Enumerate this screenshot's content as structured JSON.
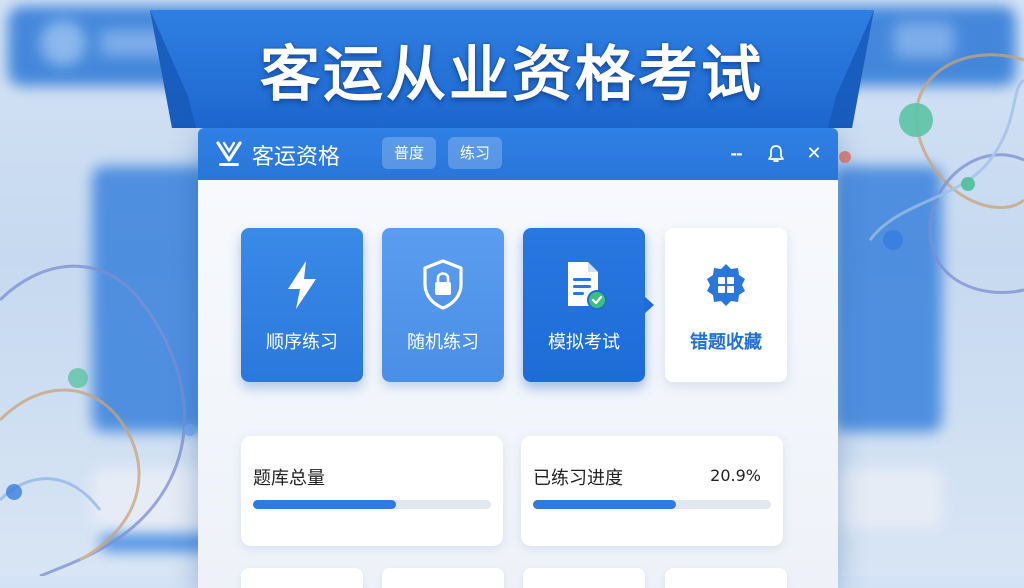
{
  "banner": {
    "title": "客运从业资格考试"
  },
  "window": {
    "app_title": "客运资格",
    "tabs": [
      {
        "label": "普度"
      },
      {
        "label": "练习"
      }
    ],
    "controls": {
      "minimize_label": "--",
      "bell_icon": "bell-icon",
      "close_label": "✕"
    }
  },
  "tiles": [
    {
      "label": "顺序练习",
      "icon": "lightning-icon"
    },
    {
      "label": "随机练习",
      "icon": "shield-lock-icon"
    },
    {
      "label": "模拟考试",
      "icon": "document-check-icon"
    },
    {
      "label": "错题收藏",
      "icon": "grid-badge-icon"
    }
  ],
  "stats": [
    {
      "title": "题库总量",
      "value": "",
      "progress": 0.6
    },
    {
      "title": "已练习进度",
      "value": "20.9%",
      "progress": 0.6
    }
  ],
  "colors": {
    "accent": "#2a76db",
    "accent_light": "#4a8fe6",
    "tile_text_dark": "#2470d4",
    "background": "#d4e3f5"
  }
}
